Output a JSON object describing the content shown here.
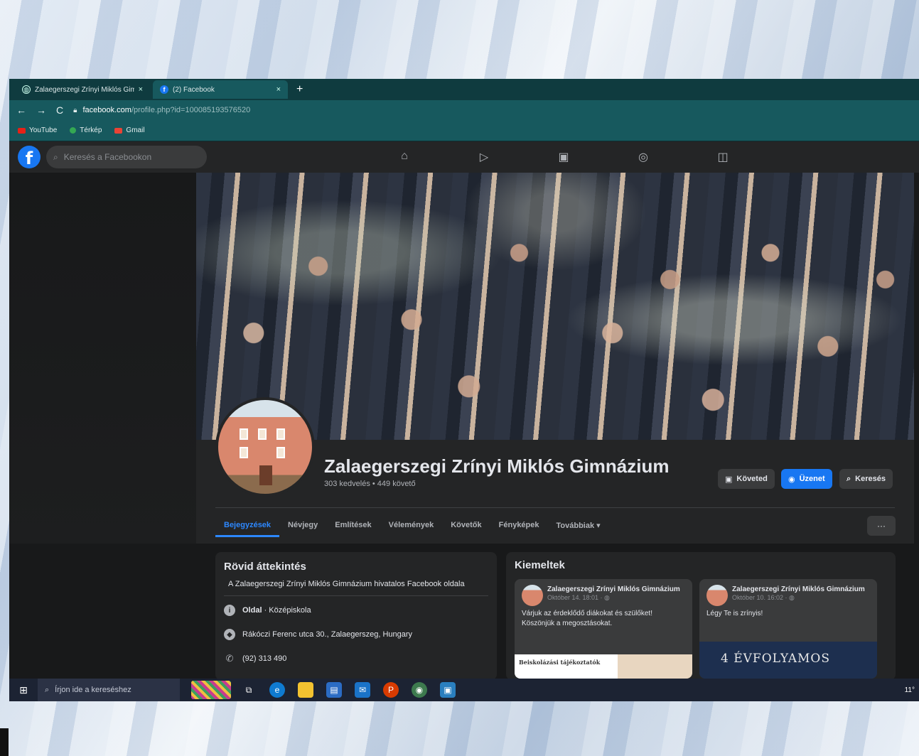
{
  "browser": {
    "tabs": [
      {
        "title": "Zalaegerszegi Zrínyi Miklós Gim",
        "close": "×"
      },
      {
        "title": "(2) Facebook",
        "close": "×"
      }
    ],
    "new_tab": "+",
    "nav": {
      "back": "←",
      "forward": "→",
      "reload": "C"
    },
    "url_host": "facebook.com",
    "url_path": "/profile.php?id=100085193576520",
    "bookmarks": [
      {
        "label": "YouTube",
        "color": "#e62117"
      },
      {
        "label": "Térkép",
        "color": "#34a853"
      },
      {
        "label": "Gmail",
        "color": "#ea4335"
      }
    ]
  },
  "fb": {
    "logo": "f",
    "search_placeholder": "Keresés a Facebookon",
    "nav_icons": [
      "home-icon",
      "watch-icon",
      "marketplace-icon",
      "groups-icon",
      "gaming-icon"
    ]
  },
  "profile": {
    "name": "Zalaegerszegi Zrínyi Miklós Gimnázium",
    "stats": "303 kedvelés • 449 követő",
    "buttons": {
      "follow": "Követed",
      "message": "Üzenet",
      "search": "Keresés"
    },
    "tabs": [
      "Bejegyzések",
      "Névjegy",
      "Említések",
      "Vélemények",
      "Követők",
      "Fényképek",
      "Továbbiak ▾"
    ],
    "more": "···"
  },
  "intro": {
    "title": "Rövid áttekintés",
    "description": "A Zalaegerszegi Zrínyi Miklós Gimnázium hivatalos Facebook oldala",
    "page_label": "Oldal",
    "page_category": "· Középiskola",
    "address": "Rákóczi Ferenc utca 30., Zalaegerszeg, Hungary",
    "phone": "(92) 313 490"
  },
  "featured": {
    "title": "Kiemeltek",
    "cards": [
      {
        "name": "Zalaegerszegi Zrínyi Miklós Gimnázium",
        "date": "Október 14. 18:01 · ◍",
        "text": "Várjuk az érdeklődő diákokat és szülőket! Köszönjük a megosztásokat.",
        "image_text": "Beiskolázási tájékoztatók"
      },
      {
        "name": "Zalaegerszegi Zrínyi Miklós Gimnázium",
        "date": "Október 10. 16:02 · ◍",
        "text": "Légy Te is zrínyis!",
        "image_text": "4 ÉVFOLYAMOS"
      }
    ]
  },
  "taskbar": {
    "search_placeholder": "Írjon ide a kereséshez",
    "tray": "11°"
  }
}
